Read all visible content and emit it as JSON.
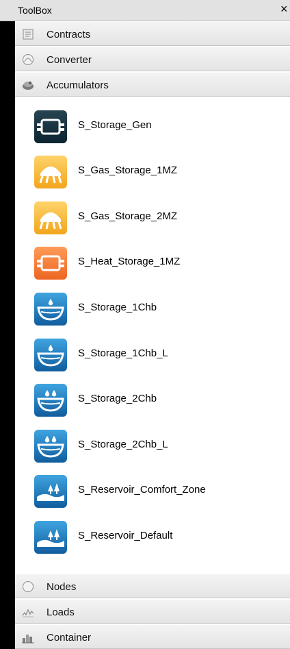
{
  "toolbox": {
    "title": "ToolBox",
    "close_symbol": "×",
    "sections_top": [
      {
        "label": "Contracts",
        "icon": "contract-icon"
      },
      {
        "label": "Converter",
        "icon": "converter-icon"
      },
      {
        "label": "Accumulators",
        "icon": "accumulator-icon"
      }
    ],
    "accumulator_items": [
      {
        "label": "S_Storage_Gen",
        "icon": "generic-storage-icon",
        "color": "#0f2e3c"
      },
      {
        "label": "S_Gas_Storage_1MZ",
        "icon": "gas-storage-icon",
        "color": "#f7b733"
      },
      {
        "label": "S_Gas_Storage_2MZ",
        "icon": "gas-storage-icon",
        "color": "#f7b733"
      },
      {
        "label": "S_Heat_Storage_1MZ",
        "icon": "heat-storage-icon",
        "color": "#f27b34"
      },
      {
        "label": "S_Storage_1Chb",
        "icon": "water-storage-icon",
        "color": "#1f7cc4"
      },
      {
        "label": "S_Storage_1Chb_L",
        "icon": "water-storage-icon",
        "color": "#1f7cc4"
      },
      {
        "label": "S_Storage_2Chb",
        "icon": "water-storage-two-drops-icon",
        "color": "#1f7cc4"
      },
      {
        "label": "S_Storage_2Chb_L",
        "icon": "water-storage-two-drops-icon",
        "color": "#1f7cc4"
      },
      {
        "label": "S_Reservoir_Comfort_Zone",
        "icon": "reservoir-icon",
        "color": "#1f7cc4"
      },
      {
        "label": "S_Reservoir_Default",
        "icon": "reservoir-icon",
        "color": "#1f7cc4"
      }
    ],
    "sections_bottom": [
      {
        "label": "Nodes",
        "icon": "nodes-icon"
      },
      {
        "label": "Loads",
        "icon": "loads-icon"
      },
      {
        "label": "Container",
        "icon": "container-icon"
      }
    ]
  }
}
